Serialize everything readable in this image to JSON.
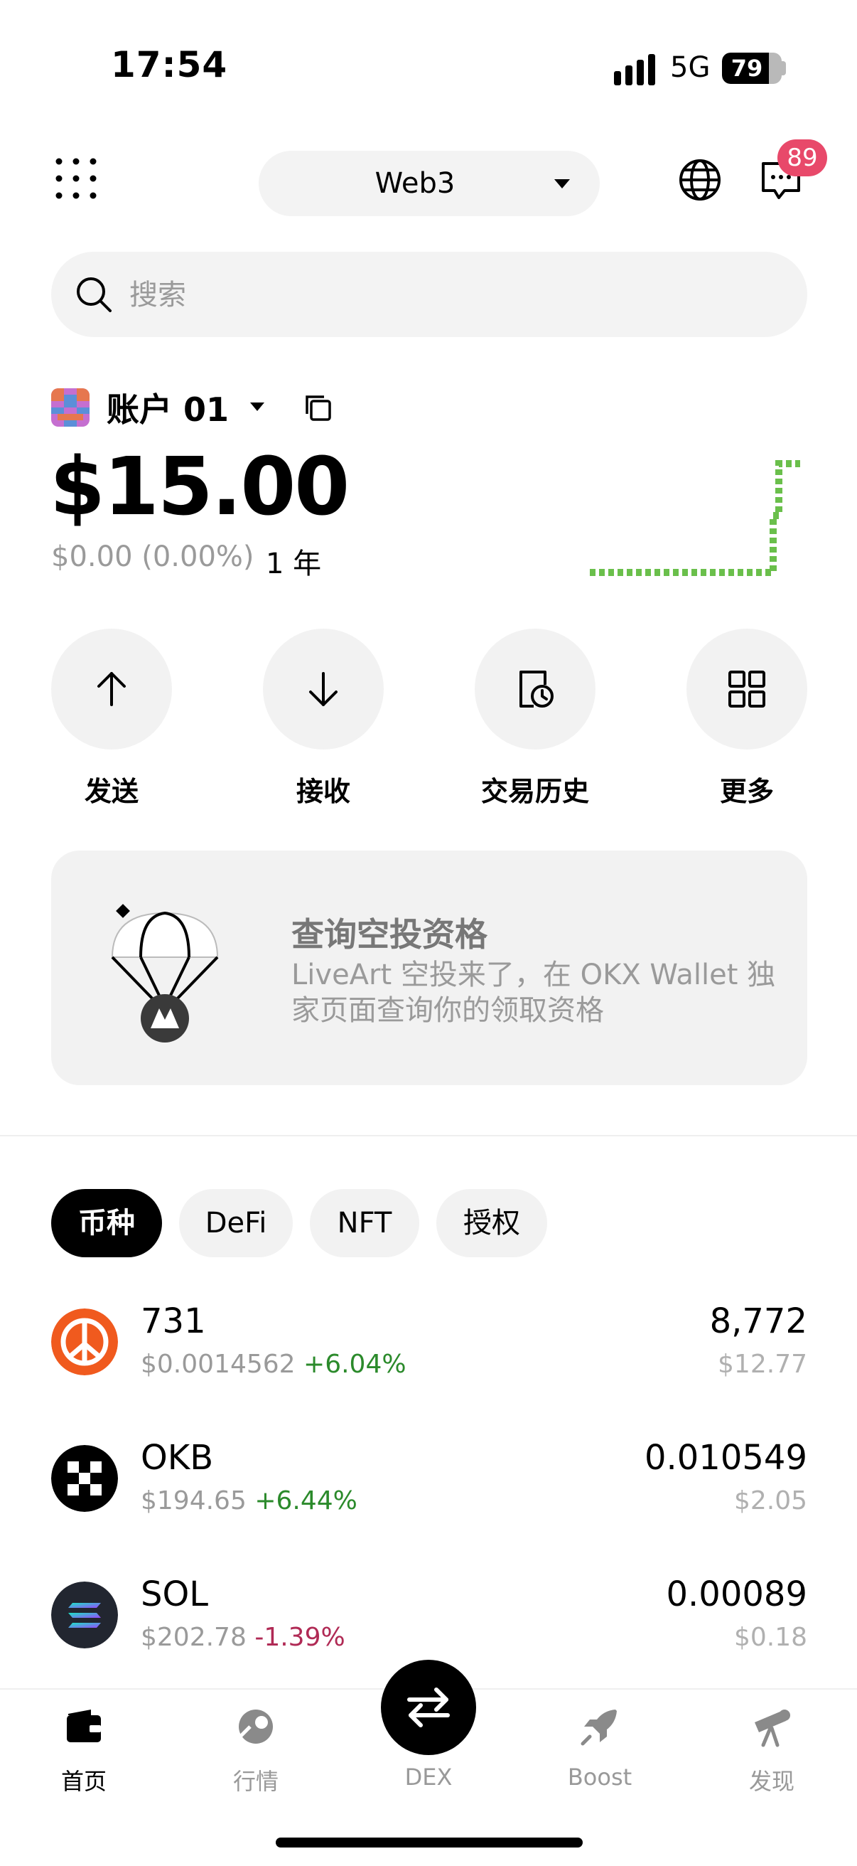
{
  "status_bar": {
    "time": "17:54",
    "network": "5G",
    "battery": "79",
    "battery_level": 0.79
  },
  "header": {
    "network_selector": "Web3",
    "notification_count": "89"
  },
  "search": {
    "placeholder": "搜索"
  },
  "account": {
    "name": "账户 01",
    "balance": "$15.00",
    "pnl": "$0.00 (0.00%)",
    "period": "1 年"
  },
  "actions": [
    {
      "label": "发送",
      "icon": "arrow-up-icon"
    },
    {
      "label": "接收",
      "icon": "arrow-down-icon"
    },
    {
      "label": "交易历史",
      "icon": "history-icon"
    },
    {
      "label": "更多",
      "icon": "grid-icon"
    }
  ],
  "promo": {
    "title": "查询空投资格",
    "description": "LiveArt 空投来了，在 OKX Wallet 独家页面查询你的领取资格"
  },
  "tabs": [
    "币种",
    "DeFi",
    "NFT",
    "授权"
  ],
  "tokens": [
    {
      "symbol": "731",
      "price": "$0.0014562",
      "change": "+6.04%",
      "amount": "8,772",
      "value": "$12.77"
    },
    {
      "symbol": "OKB",
      "price": "$194.65",
      "change": "+6.44%",
      "amount": "0.010549",
      "value": "$2.05"
    },
    {
      "symbol": "SOL",
      "price": "$202.78",
      "change": "-1.39%",
      "amount": "0.00089",
      "value": "$0.18"
    }
  ],
  "bottom_nav": {
    "items": [
      {
        "label": "首页",
        "icon": "wallet-icon"
      },
      {
        "label": "行情",
        "icon": "market-icon"
      },
      {
        "label": "DEX",
        "icon": "swap-icon"
      },
      {
        "label": "Boost",
        "icon": "rocket-icon"
      },
      {
        "label": "发现",
        "icon": "telescope-icon"
      }
    ]
  },
  "colors": {
    "up": "#2b8a2b",
    "down": "#b02a55",
    "badge": "#e8496a",
    "sparkline": "#6abf4b"
  }
}
